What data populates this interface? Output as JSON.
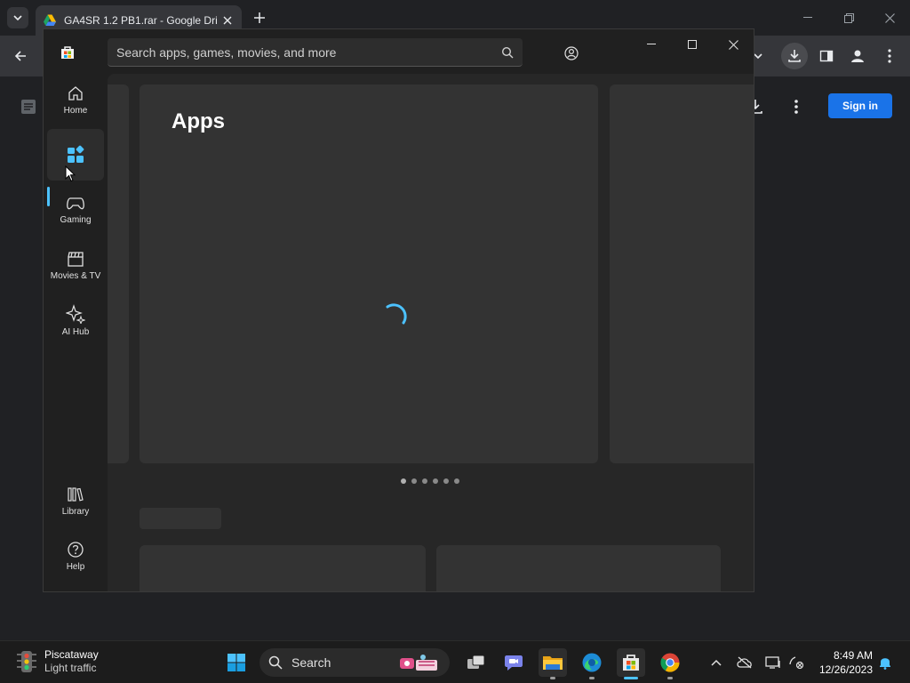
{
  "browser": {
    "tab_title": "GA4SR 1.2 PB1.rar - Google Dri",
    "sign_in_label": "Sign in"
  },
  "store": {
    "search_placeholder": "Search apps, games, movies, and more",
    "nav": {
      "home": "Home",
      "apps": "Apps",
      "gaming": "Gaming",
      "movies": "Movies & TV",
      "ai_hub": "AI Hub",
      "library": "Library",
      "help": "Help"
    },
    "hero_title": "Apps",
    "carousel_dots": 6,
    "accent_color": "#4cc2ff"
  },
  "taskbar": {
    "weather_city": "Piscataway",
    "weather_condition": "Light traffic",
    "search_label": "Search",
    "time": "8:49 AM",
    "date": "12/26/2023"
  }
}
